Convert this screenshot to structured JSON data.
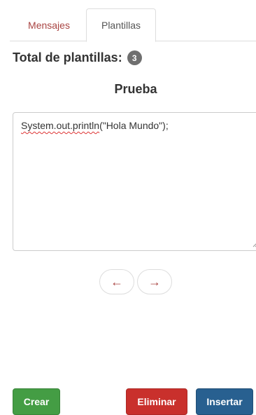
{
  "tabs": [
    {
      "label": "Mensajes",
      "active": false
    },
    {
      "label": "Plantillas",
      "active": true
    }
  ],
  "summary": {
    "label": "Total de plantillas:",
    "count": "3"
  },
  "template": {
    "name": "Prueba",
    "content_misspelled": "System.out.println",
    "content_rest": "(\"Hola Mundo\");"
  },
  "navigation": {
    "prev": "←",
    "next": "→"
  },
  "actions": {
    "create": "Crear",
    "delete": "Eliminar",
    "insert": "Insertar"
  },
  "colors": {
    "link": "#a94442",
    "success": "#449d44",
    "danger": "#c9302c",
    "primary": "#286090",
    "badge": "#6f6f6f"
  }
}
